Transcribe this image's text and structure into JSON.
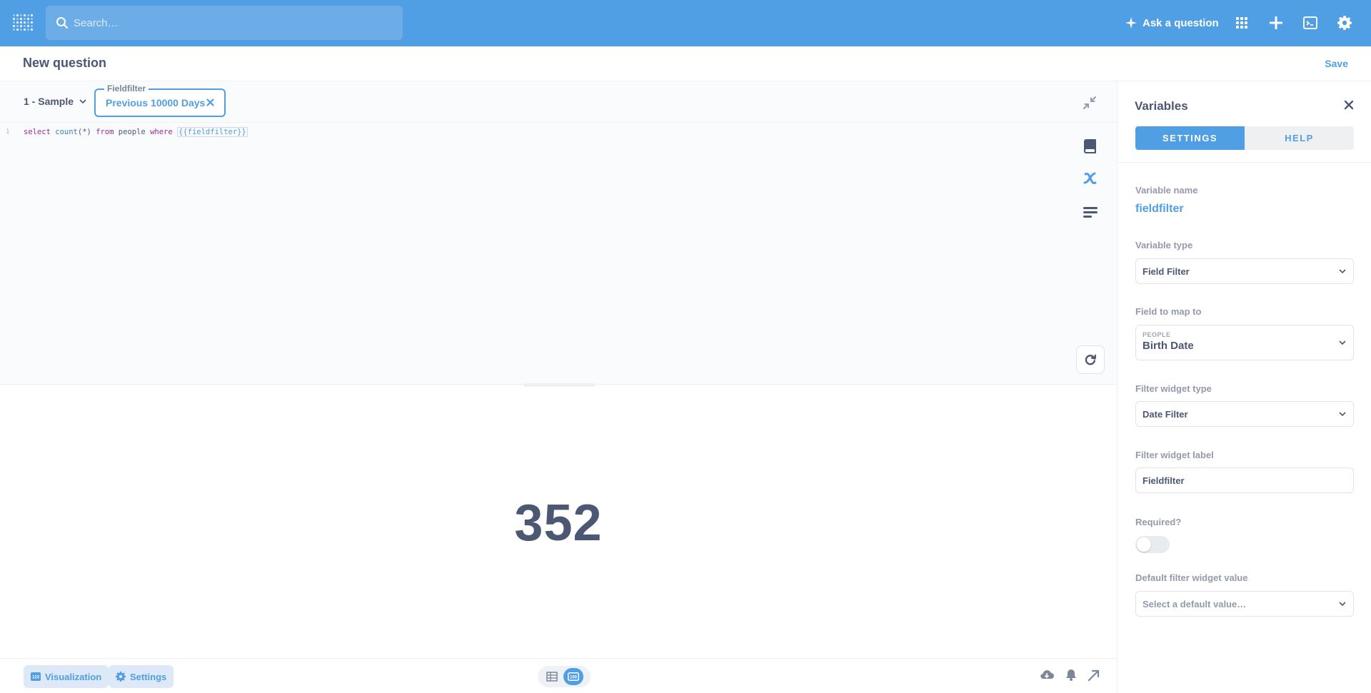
{
  "nav": {
    "search_placeholder": "Search…",
    "ask_label": "Ask a question",
    "brand_color": "#509ee3"
  },
  "header": {
    "title": "New question",
    "save_label": "Save"
  },
  "editor": {
    "database": "1 - Sample",
    "parameter": {
      "label": "Fieldfilter",
      "value": "Previous 10000 Days"
    },
    "line_number": "1",
    "query": {
      "select": "select",
      "count": "count",
      "count_args": "(*)",
      "from": "from",
      "table": "people",
      "where": "where",
      "tag": "{{fieldfilter}}"
    }
  },
  "result": {
    "value": "352"
  },
  "footer": {
    "visualization_label": "Visualization",
    "settings_label": "Settings",
    "viz_badge": "100"
  },
  "sidebar": {
    "title": "Variables",
    "tabs": [
      {
        "label": "SETTINGS",
        "active": true
      },
      {
        "label": "HELP",
        "active": false
      }
    ],
    "variable_name_label": "Variable name",
    "variable_name": "fieldfilter",
    "variable_type_label": "Variable type",
    "variable_type": "Field Filter",
    "field_map_label": "Field to map to",
    "field_table": "PEOPLE",
    "field_name": "Birth Date",
    "widget_type_label": "Filter widget type",
    "widget_type": "Date Filter",
    "widget_label_label": "Filter widget label",
    "widget_label": "Fieldfilter",
    "required_label": "Required?",
    "required": false,
    "default_label": "Default filter widget value",
    "default_placeholder": "Select a default value…"
  }
}
